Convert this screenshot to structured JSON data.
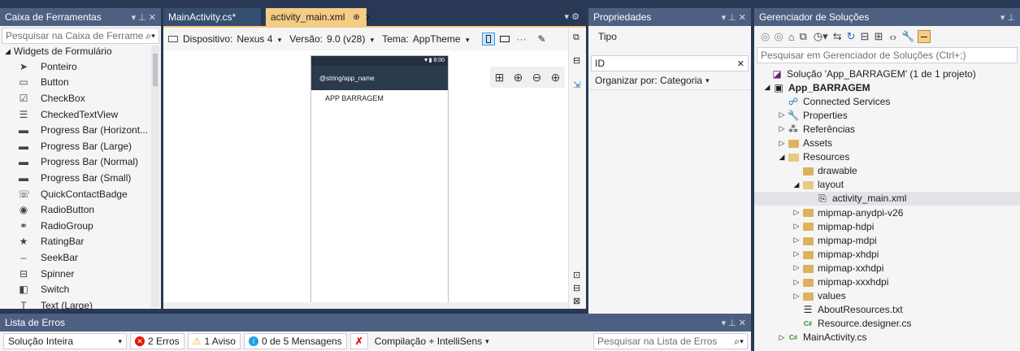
{
  "toolbox": {
    "title": "Caixa de Ferramentas",
    "controls": "▾ ⊥ ✕",
    "search_placeholder": "Pesquisar na Caixa de Ferrame",
    "category": "Widgets de Formulário",
    "items": [
      {
        "label": "Ponteiro",
        "icon": "pointer-icon",
        "glyph": "➤"
      },
      {
        "label": "Button",
        "icon": "button-icon",
        "glyph": "▭"
      },
      {
        "label": "CheckBox",
        "icon": "checkbox-icon",
        "glyph": "☑"
      },
      {
        "label": "CheckedTextView",
        "icon": "checked-text-icon",
        "glyph": "☰"
      },
      {
        "label": "Progress Bar (Horizont...",
        "icon": "progress-bar-icon",
        "glyph": "▬"
      },
      {
        "label": "Progress Bar (Large)",
        "icon": "progress-bar-icon",
        "glyph": "▬"
      },
      {
        "label": "Progress Bar (Normal)",
        "icon": "progress-bar-icon",
        "glyph": "▬"
      },
      {
        "label": "Progress Bar (Small)",
        "icon": "progress-bar-icon",
        "glyph": "▬"
      },
      {
        "label": "QuickContactBadge",
        "icon": "contact-badge-icon",
        "glyph": "☏"
      },
      {
        "label": "RadioButton",
        "icon": "radio-icon",
        "glyph": "◉"
      },
      {
        "label": "RadioGroup",
        "icon": "radio-group-icon",
        "glyph": "⚭"
      },
      {
        "label": "RatingBar",
        "icon": "rating-icon",
        "glyph": "★"
      },
      {
        "label": "SeekBar",
        "icon": "seekbar-icon",
        "glyph": "‒"
      },
      {
        "label": "Spinner",
        "icon": "spinner-icon",
        "glyph": "⊟"
      },
      {
        "label": "Switch",
        "icon": "switch-icon",
        "glyph": "◧"
      },
      {
        "label": "Text (Large)",
        "icon": "text-icon",
        "glyph": "T"
      }
    ]
  },
  "editor": {
    "tabs": [
      {
        "label": "MainActivity.cs*",
        "active": false
      },
      {
        "label": "activity_main.xml",
        "active": true,
        "pin": "⊕",
        "close": "✕"
      }
    ],
    "tab_overflow": "▾ ⚙",
    "toolbar": {
      "device_label": "Dispositivo:",
      "device_value": "Nexus 4",
      "version_label": "Versão:",
      "version_value": "9.0 (v28)",
      "theme_label": "Tema:",
      "theme_value": "AppTheme",
      "dropdown": "▾",
      "more": "···"
    },
    "phone": {
      "status_time": "8:00",
      "app_bar_title": "@string/app_name",
      "content_text": "APP BARRAGEM"
    }
  },
  "properties": {
    "title": "Propriedades",
    "controls": "▾ ⊥ ✕",
    "type_label": "Tipo",
    "id_value": "ID",
    "id_clear": "✕",
    "organize_label": "Organizar por: Categoria",
    "dropdown": "▾"
  },
  "solution": {
    "title": "Gerenciador de Soluções",
    "controls": "▾ ⊥",
    "search_placeholder": "Pesquisar em Gerenciador de Soluções (Ctrl+;)",
    "tree": [
      {
        "label": "Solução 'App_BARRAGEM' (1 de 1 projeto)",
        "level": 0,
        "exp": "",
        "icon": "solution-icon",
        "bold": false
      },
      {
        "label": "App_BARRAGEM",
        "level": 1,
        "exp": "◢",
        "icon": "project-icon",
        "bold": true
      },
      {
        "label": "Connected Services",
        "level": 2,
        "exp": "",
        "icon": "connected-services-icon",
        "bold": false
      },
      {
        "label": "Properties",
        "level": 2,
        "exp": "▷",
        "icon": "wrench-icon",
        "bold": false
      },
      {
        "label": "Referências",
        "level": 2,
        "exp": "▷",
        "icon": "references-icon",
        "bold": false
      },
      {
        "label": "Assets",
        "level": 2,
        "exp": "▷",
        "icon": "folder-icon",
        "bold": false
      },
      {
        "label": "Resources",
        "level": 2,
        "exp": "◢",
        "icon": "folder-open-icon",
        "bold": false
      },
      {
        "label": "drawable",
        "level": 3,
        "exp": "",
        "icon": "folder-icon",
        "bold": false
      },
      {
        "label": "layout",
        "level": 3,
        "exp": "◢",
        "icon": "folder-open-icon",
        "bold": false
      },
      {
        "label": "activity_main.xml",
        "level": 4,
        "exp": "",
        "icon": "xml-file-icon",
        "bold": false,
        "selected": true
      },
      {
        "label": "mipmap-anydpi-v26",
        "level": 3,
        "exp": "▷",
        "icon": "folder-icon",
        "bold": false
      },
      {
        "label": "mipmap-hdpi",
        "level": 3,
        "exp": "▷",
        "icon": "folder-icon",
        "bold": false
      },
      {
        "label": "mipmap-mdpi",
        "level": 3,
        "exp": "▷",
        "icon": "folder-icon",
        "bold": false
      },
      {
        "label": "mipmap-xhdpi",
        "level": 3,
        "exp": "▷",
        "icon": "folder-icon",
        "bold": false
      },
      {
        "label": "mipmap-xxhdpi",
        "level": 3,
        "exp": "▷",
        "icon": "folder-icon",
        "bold": false
      },
      {
        "label": "mipmap-xxxhdpi",
        "level": 3,
        "exp": "▷",
        "icon": "folder-icon",
        "bold": false
      },
      {
        "label": "values",
        "level": 3,
        "exp": "▷",
        "icon": "folder-icon",
        "bold": false
      },
      {
        "label": "AboutResources.txt",
        "level": 3,
        "exp": "",
        "icon": "text-file-icon",
        "bold": false
      },
      {
        "label": "Resource.designer.cs",
        "level": 3,
        "exp": "",
        "icon": "csharp-file-icon",
        "bold": false
      },
      {
        "label": "MainActivity.cs",
        "level": 2,
        "exp": "▷",
        "icon": "csharp-file-icon",
        "bold": false
      }
    ]
  },
  "error_list": {
    "title": "Lista de Erros",
    "controls": "▾ ⊥ ✕",
    "scope": "Solução Inteira",
    "errors": "2 Erros",
    "warnings": "1 Aviso",
    "messages": "0 de 5 Mensagens",
    "build_filter": "Compilação + IntelliSens",
    "search_placeholder": "Pesquisar na Lista de Erros"
  }
}
